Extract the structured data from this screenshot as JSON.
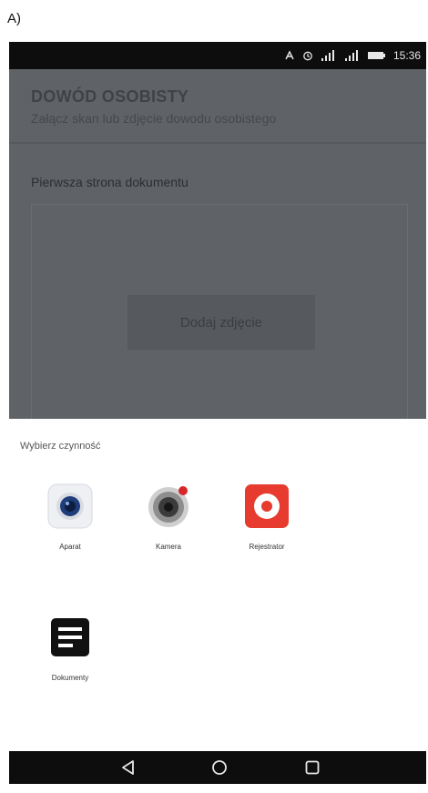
{
  "frame_label": "A)",
  "status_bar": {
    "time": "15:36",
    "icons": [
      "nfc-icon",
      "alarm-icon",
      "signal-icon",
      "signal-icon",
      "battery-icon"
    ]
  },
  "document_screen": {
    "title": "DOWÓD OSOBISTY",
    "subtitle": "Załącz skan lub zdjęcie dowodu osobistego",
    "section_label": "Pierwsza strona dokumentu",
    "add_photo_label": "Dodaj zdjęcie"
  },
  "chooser": {
    "title": "Wybierz czynność",
    "apps": [
      {
        "label": "Aparat",
        "icon": "camera-app-icon",
        "color": "#1f3d7a"
      },
      {
        "label": "Kamera",
        "icon": "video-camera-app-icon",
        "color": "#9a9a9a"
      },
      {
        "label": "Rejestrator",
        "icon": "recorder-app-icon",
        "color": "#e63b2e"
      },
      {
        "label": "Dokumenty",
        "icon": "docs-app-icon",
        "color": "#111111"
      }
    ]
  },
  "nav_bar": {
    "buttons": [
      "back-icon",
      "home-icon",
      "recents-icon"
    ]
  },
  "colors": {
    "status_bar": "#0d0d0d",
    "dim_overlay": "#5f6266",
    "sheet": "#ffffff",
    "recorder_red": "#e63b2e"
  }
}
